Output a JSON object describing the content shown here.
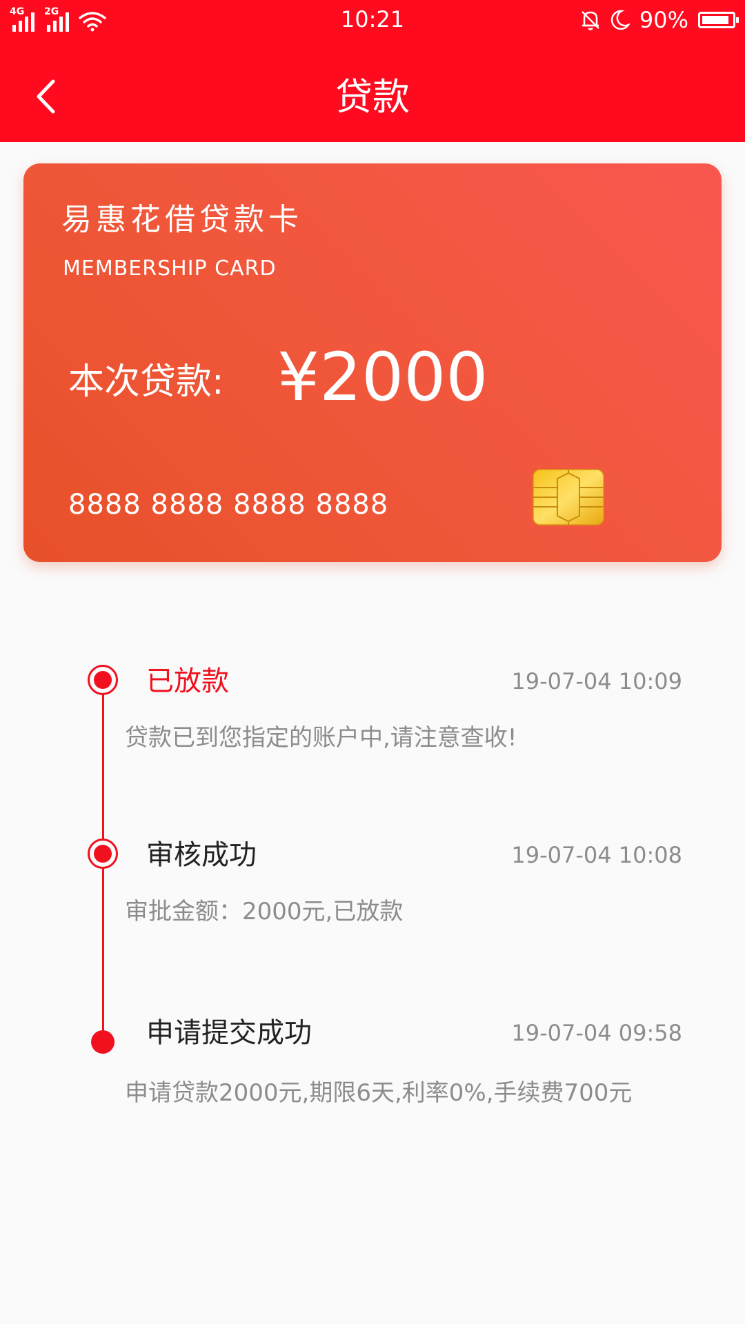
{
  "status_bar": {
    "net1": "4G",
    "net2": "2G",
    "time": "10:21",
    "battery_text": "90%",
    "battery_level": 0.9
  },
  "header": {
    "title": "贷款",
    "back_icon": "chevron-left-icon"
  },
  "card": {
    "title": "易惠花借贷款卡",
    "subtitle": "MEMBERSHIP CARD",
    "loan_label": "本次贷款:",
    "loan_amount": "¥2000",
    "card_number": "8888 8888 8888 8888",
    "chip_icon": "card-chip-icon",
    "colors": {
      "gradient_start": "#e8502a",
      "gradient_end": "#f8574e"
    }
  },
  "timeline": {
    "accent_color": "#f0101e",
    "items": [
      {
        "title": "已放款",
        "time": "19-07-04 10:09",
        "desc": "贷款已到您指定的账户中,请注意查收!",
        "active": true
      },
      {
        "title": "审核成功",
        "time": "19-07-04 10:08",
        "desc": "审批金额：2000元,已放款",
        "active": false
      },
      {
        "title": "申请提交成功",
        "time": "19-07-04 09:58",
        "desc": "申请贷款2000元,期限6天,利率0%,手续费700元",
        "active": false
      }
    ]
  },
  "theme": {
    "header_red": "#ff0a1e",
    "background": "#fafafa"
  }
}
